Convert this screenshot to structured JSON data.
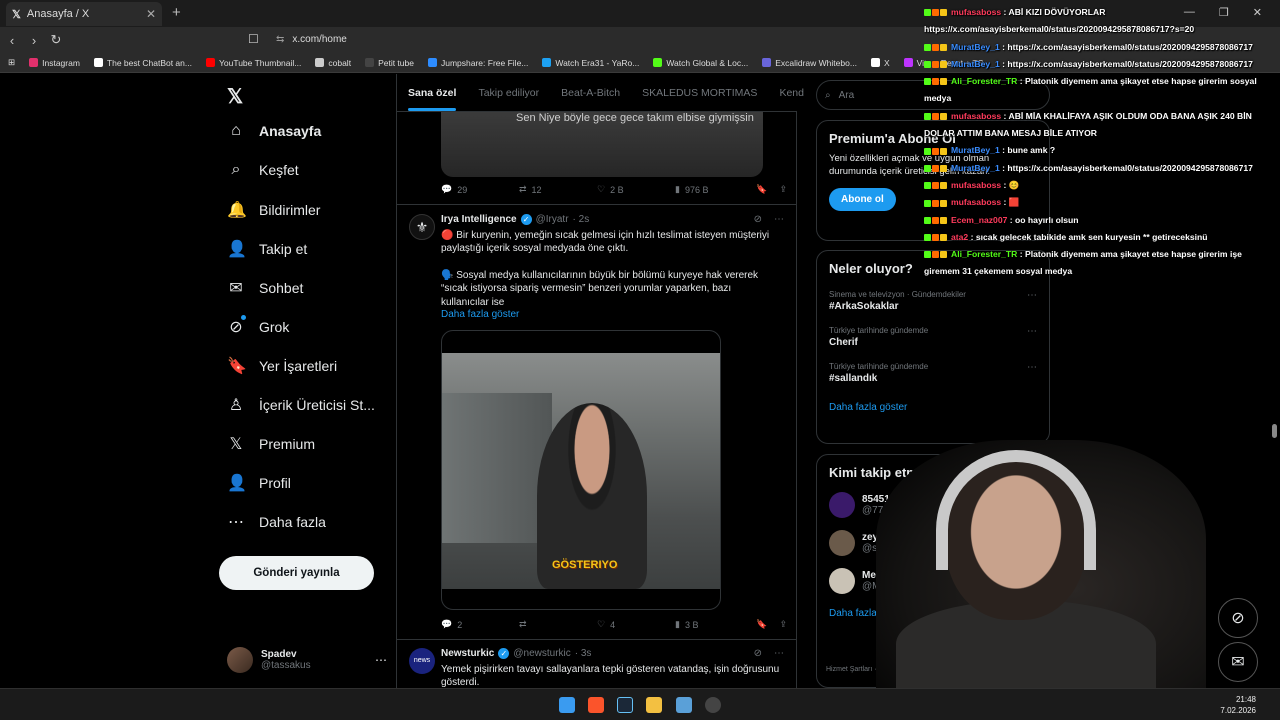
{
  "browser": {
    "tab_title": "Anasayfa / X",
    "tab_close": "✕",
    "new_tab": "+",
    "url": "x.com/home",
    "window_controls": [
      "—",
      "❐",
      "✕"
    ],
    "bookmarks": [
      {
        "label": "Instagram",
        "color": "#e1306c"
      },
      {
        "label": "The best ChatBot an...",
        "color": "#ffffff"
      },
      {
        "label": "YouTube Thumbnail...",
        "color": "#ff0000"
      },
      {
        "label": "cobalt",
        "color": "#cccccc"
      },
      {
        "label": "Petit tube",
        "color": "#444444"
      },
      {
        "label": "Jumpshare: Free File...",
        "color": "#2d8cff"
      },
      {
        "label": "Watch Era31 - YaRo...",
        "color": "#1da1f2"
      },
      {
        "label": "Watch Global & Loc...",
        "color": "#53fc18"
      },
      {
        "label": "Excalidraw Whitebo...",
        "color": "#6965db"
      },
      {
        "label": "X",
        "color": "#ffffff"
      },
      {
        "label": "Vite + React + TS",
        "color": "#bd34fe"
      }
    ]
  },
  "nav": {
    "items": [
      {
        "icon": "home-icon",
        "glyph": "⌂",
        "label": "Anasayfa",
        "active": true
      },
      {
        "icon": "search-icon",
        "glyph": "⌕",
        "label": "Keşfet"
      },
      {
        "icon": "bell-icon",
        "glyph": "🔔",
        "label": "Bildirimler"
      },
      {
        "icon": "add-person-icon",
        "glyph": "👤",
        "label": "Takip et"
      },
      {
        "icon": "mail-icon",
        "glyph": "✉",
        "label": "Sohbet"
      },
      {
        "icon": "grok-icon",
        "glyph": "⊘",
        "label": "Grok"
      },
      {
        "icon": "bookmark-icon",
        "glyph": "🔖",
        "label": "Yer İşaretleri"
      },
      {
        "icon": "creator-icon",
        "glyph": "♙",
        "label": "İçerik Üreticisi St..."
      },
      {
        "icon": "x-icon",
        "glyph": "𝕏",
        "label": "Premium"
      },
      {
        "icon": "profile-icon",
        "glyph": "👤",
        "label": "Profil"
      },
      {
        "icon": "more-icon",
        "glyph": "⋯",
        "label": "Daha fazla"
      }
    ],
    "post_button": "Gönderi yayınla",
    "account": {
      "name": "Spadev",
      "handle": "@tassakus"
    }
  },
  "timeline": {
    "tabs": [
      "Sana özel",
      "Takip ediliyor",
      "Beat-A-Bitch",
      "SKALEDUS MORTIMAS",
      "Kend"
    ],
    "tweet0": {
      "media_caption": "Sen Niye böyle gece gece takım elbise giymişsin",
      "replies": "29",
      "reposts": "12",
      "likes": "2 B",
      "views": "976 B"
    },
    "tweet1": {
      "name": "Irya Intelligence",
      "handle": "@Iryatr",
      "time": "· 2s",
      "text1": "🔴 Bir kuryenin, yemeğin sıcak gelmesi için hızlı teslimat isteyen müşteriyi paylaştığı içerik sosyal medyada öne çıktı.",
      "text2": "🗣️ Sosyal medya kullanıcılarının büyük bir bölümü kuryeye hak vererek “sıcak istiyorsa sipariş vermesin” benzeri yorumlar yaparken, bazı kullanıcılar ise",
      "show_more": "Daha fazla göster",
      "video_caption": "GÖSTERIYO",
      "replies": "2",
      "reposts": "",
      "likes": "4",
      "views": "3 B"
    },
    "tweet2": {
      "name": "Newsturkic",
      "handle": "@newsturkic",
      "time": "· 3s",
      "avatar_text": "news",
      "text": "Yemek pişirirken tavayı sallayanlara tepki gösteren vatandaş, işin doğrusunu gösterdi."
    }
  },
  "right": {
    "search_placeholder": "Ara",
    "premium": {
      "title": "Premium'a Abone Ol",
      "desc": "Yeni özellikleri açmak ve uygun olman durumunda içerik üreticisi geliri kazan.",
      "button": "Abone ol"
    },
    "trends": {
      "title": "Neler oluyor?",
      "items": [
        {
          "context": "Sinema ve televizyon · Gündemdekiler",
          "name": "#ArkaSokaklar"
        },
        {
          "context": "Türkiye tarihinde gündemde",
          "name": "Cherif"
        },
        {
          "context": "Türkiye tarihinde gündemde",
          "name": "#sallandık"
        }
      ],
      "show_more": "Daha fazla göster"
    },
    "follow": {
      "title": "Kimi takip etmeli",
      "items": [
        {
          "name": "854512mountain",
          "handle": "@777deprem",
          "color": "#3a1a6a"
        },
        {
          "name": "zeys",
          "handle": "@stawmef",
          "color": "#6a5a4a"
        },
        {
          "name": "Mehmet Y",
          "handle": "@Mehmet",
          "color": "#c9c2b5"
        }
      ],
      "show_more": "Daha fazla göster"
    },
    "footer": "Hizmet Şartları  ·  Imprint  ·  Erişi"
  },
  "chat": [
    {
      "user": "mufasaboss",
      "color": "#ff3b5c",
      "text": "ABİ KIZI DÖVÜYORLAR https://x.com/asayisberkemal0/status/2020094295878086717?s=20"
    },
    {
      "user": "MuratBey_1",
      "color": "#3a8dff",
      "text": "https://x.com/asayisberkemal0/status/2020094295878086717"
    },
    {
      "user": "MuratBey_1",
      "color": "#3a8dff",
      "text": "https://x.com/asayisberkemal0/status/2020094295878086717"
    },
    {
      "user": "Ali_Forester_TR",
      "color": "#53fc18",
      "text": "Platonik diyemem ama şikayet etse hapse girerim sosyal medya"
    },
    {
      "user": "mufasaboss",
      "color": "#ff3b5c",
      "text": "ABİ MİA KHALİFAYA AŞIK OLDUM ODA BANA AŞIK 240 BİN DOLAR ATTIM BANA MESAJ BİLE ATIYOR"
    },
    {
      "user": "MuratBey_1",
      "color": "#3a8dff",
      "text": "bune amk ?"
    },
    {
      "user": "MuratBey_1",
      "color": "#3a8dff",
      "text": "https://x.com/asayisberkemal0/status/2020094295878086717"
    },
    {
      "user": "mufasaboss",
      "color": "#ff3b5c",
      "text": "😊"
    },
    {
      "user": "mufasaboss",
      "color": "#ff3b5c",
      "text": "🟥"
    },
    {
      "user": "Ecem_naz007",
      "color": "#ff3b5c",
      "text": "oo hayırlı olsun"
    },
    {
      "user": "ata2",
      "color": "#ff3b5c",
      "text": "sıcak gelecek tabikide amk sen kuryesin ** getireceksinü"
    },
    {
      "user": "Ali_Forester_TR",
      "color": "#53fc18",
      "text": "Platonik diyemem ama şikayet etse hapse girerim işe giremem 31 çekemem sosyal medya"
    }
  ],
  "taskbar": {
    "time": "21:48",
    "date": "7.02.2026"
  }
}
